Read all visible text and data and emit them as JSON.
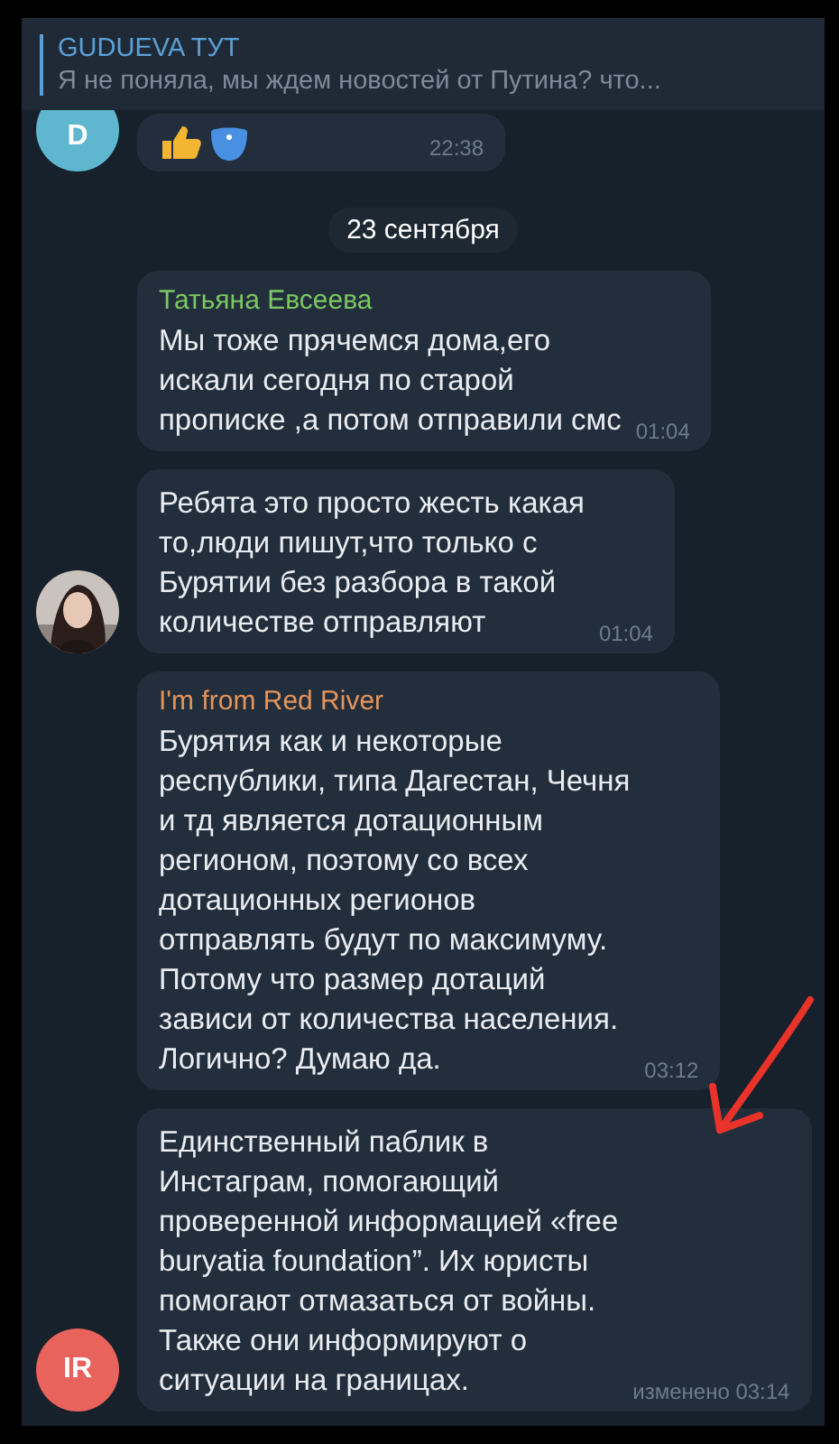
{
  "pinned": {
    "title": "GUDUEVA ТУТ",
    "text": "Я не поняла, мы ждем новостей от Путина? что..."
  },
  "messages": [
    {
      "kind": "reactions",
      "avatar": {
        "kind": "initials",
        "text": "D",
        "color": "#5fb7cf"
      },
      "time": "22:38"
    },
    {
      "kind": "date",
      "text": "23 сентября"
    },
    {
      "kind": "text",
      "sender": "Татьяна Евсеева",
      "color": "#7bc862",
      "text": "Мы тоже прячемся дома,его\nискали сегодня по старой\nпрописке ,а потом отправили смс",
      "time": "01:04"
    },
    {
      "kind": "text",
      "text": "Ребята это просто жесть какая\nто,люди пишут,что только с\nБурятии без разбора в такой\nколичестве отправляют",
      "time": "01:04"
    },
    {
      "kind": "text",
      "sender": "I'm from Red River",
      "color": "#e5945a",
      "text": "Бурятия как и некоторые\nреспублики, типа Дагестан, Чечня\nи тд является дотационным\nрегионом, поэтому со всех\nдотационных регионов\nотправлять будут по максимуму.\nПотому что размер дотаций\nзависи от количества населения.\nЛогично? Думаю да.",
      "time": "03:12"
    },
    {
      "kind": "text",
      "avatar": {
        "kind": "initials",
        "text": "IR",
        "color": "#e8635c"
      },
      "text": "Единственный паблик в\nИнстаграм, помогающий\nпроверенной информацией «free\nburyatia foundation”. Их юристы\nпомогают отмазаться от войны.\nТакже они информируют о\nситуации на границах.",
      "time": "изменено 03:14"
    }
  ]
}
